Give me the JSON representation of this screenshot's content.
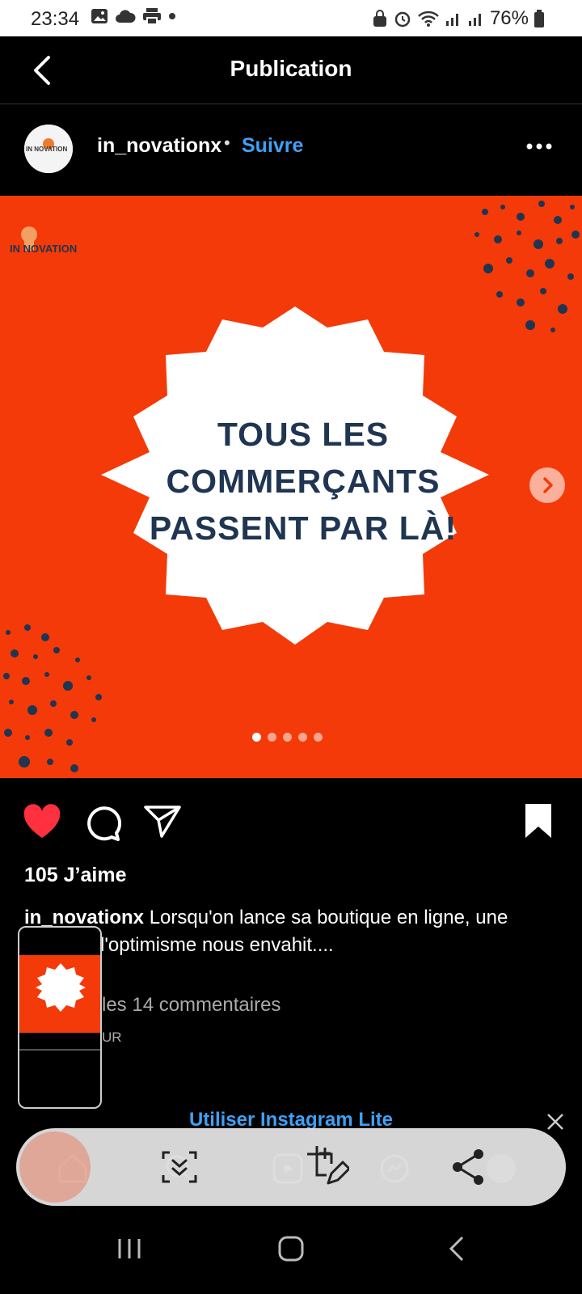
{
  "status_bar": {
    "time": "23:34",
    "battery": "76%",
    "icons_left": [
      "image-icon",
      "cloud-icon",
      "print-icon",
      "dot-icon"
    ],
    "icons_right": [
      "lock-icon",
      "alarm-icon",
      "wifi-icon",
      "signal-icon",
      "signal-icon",
      "battery-icon"
    ]
  },
  "header": {
    "title": "Publication"
  },
  "post": {
    "username": "in_novationx",
    "separator": "•",
    "follow_label": "Suivre",
    "avatar_text": "IN NOVATION",
    "logo_text": "IN NOVATION",
    "image_headline_lines": [
      "TOUS LES",
      "COMMERÇANTS",
      "PASSENT PAR LÀ!"
    ],
    "carousel_count": 5,
    "carousel_index": 1,
    "likes": "105 J’aime",
    "caption_user": "in_novationx",
    "caption_text": " Lorsqu'on lance sa boutique en ligne, une",
    "caption_text2": "l'optimisme nous envahit....",
    "comments_link": "les 14 commentaires",
    "date_fragment": "UR"
  },
  "promo": {
    "lite_label": "Utiliser Instagram Lite"
  },
  "colors": {
    "brand_orange": "#f43a08",
    "accent_blue": "#3ea1f5",
    "like_red": "#ff3040",
    "headline_navy": "#1f3551"
  },
  "capture_toolbar": {
    "items": [
      "scroll-capture-icon",
      "edit-crop-icon",
      "share-icon"
    ]
  }
}
